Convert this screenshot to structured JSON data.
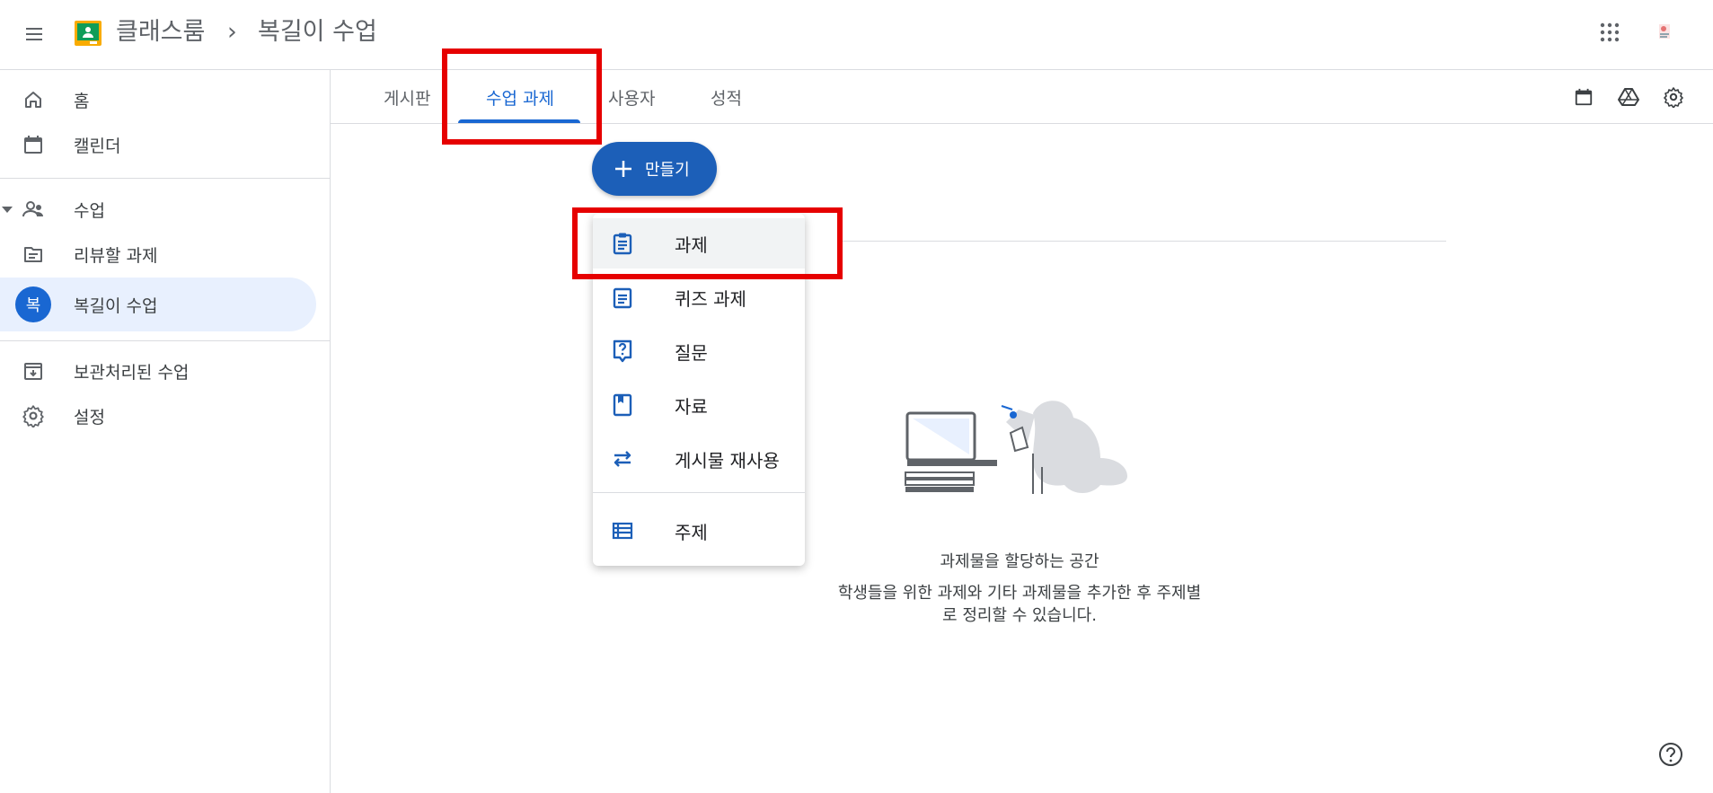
{
  "header": {
    "app_title": "클래스룸",
    "breadcrumb_separator": "›",
    "class_title": "복길이 수업"
  },
  "sidebar": {
    "home_label": "홈",
    "calendar_label": "캘린더",
    "classes_label": "수업",
    "review_label": "리뷰할 과제",
    "class_item_label": "복길이 수업",
    "class_item_initial": "복",
    "archived_label": "보관처리된 수업",
    "settings_label": "설정"
  },
  "tabs": {
    "stream": "게시판",
    "classwork": "수업 과제",
    "people": "사용자",
    "grades": "성적"
  },
  "create_button": {
    "label": "만들기"
  },
  "create_menu": {
    "items": [
      {
        "label": "과제",
        "icon": "assignment-icon"
      },
      {
        "label": "퀴즈 과제",
        "icon": "quiz-assignment-icon"
      },
      {
        "label": "질문",
        "icon": "question-icon"
      },
      {
        "label": "자료",
        "icon": "material-icon"
      },
      {
        "label": "게시물 재사용",
        "icon": "reuse-post-icon"
      },
      {
        "label": "주제",
        "icon": "topic-icon"
      }
    ]
  },
  "empty_state": {
    "title": "과제물을 할당하는 공간",
    "description_line1": "학생들을 위한 과제와 기타 과제물을 추가한 후 주제별",
    "description_line2": "로 정리할 수 있습니다."
  },
  "colors": {
    "accent": "#1967d2",
    "create_button": "#1c5fb8",
    "highlight": "#e60000",
    "active_nav_bg": "#e8f0fe"
  }
}
